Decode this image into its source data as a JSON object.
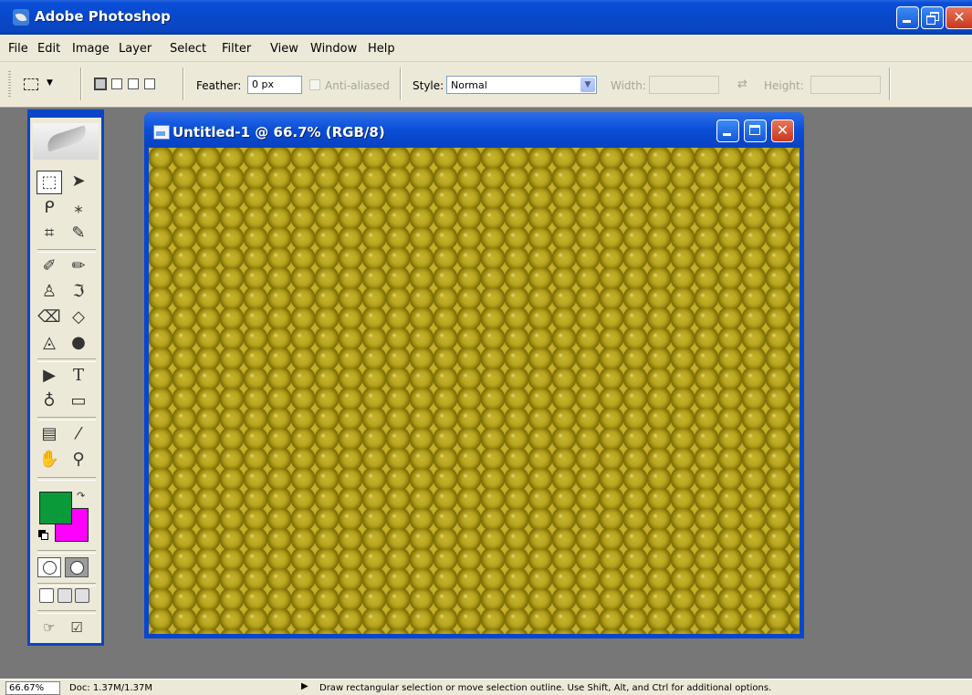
{
  "app": {
    "title": "Adobe Photoshop"
  },
  "menu": [
    "File",
    "Edit",
    "Image",
    "Layer",
    "Select",
    "Filter",
    "View",
    "Window",
    "Help"
  ],
  "options": {
    "feather_label": "Feather:",
    "feather_value": "0 px",
    "antialiased_label": "Anti-aliased",
    "style_label": "Style:",
    "style_value": "Normal",
    "width_label": "Width:",
    "height_label": "Height:"
  },
  "toolbox": {
    "tools": [
      "rectangular-marquee-tool",
      "move-tool",
      "lasso-tool",
      "magic-wand-tool",
      "crop-tool",
      "slice-tool",
      "healing-brush-tool",
      "brush-tool",
      "clone-stamp-tool",
      "history-brush-tool",
      "eraser-tool",
      "paint-bucket-tool",
      "blur-tool",
      "dodge-tool",
      "path-selection-tool",
      "type-tool",
      "pen-tool",
      "rectangle-tool",
      "notes-tool",
      "eyedropper-tool",
      "hand-tool",
      "zoom-tool"
    ],
    "foreground_color": "#0a9a3a",
    "background_color": "#ff00ff"
  },
  "document": {
    "title": "Untitled-1 @ 66.7% (RGB/8)",
    "pattern": "yellow-hexagon-honeycomb",
    "pattern_color": "#b9a61f"
  },
  "status": {
    "zoom": "66.67%",
    "doc": "Doc: 1.37M/1.37M",
    "hint": "Draw rectangular selection or move selection outline.  Use Shift, Alt, and Ctrl for additional options."
  }
}
